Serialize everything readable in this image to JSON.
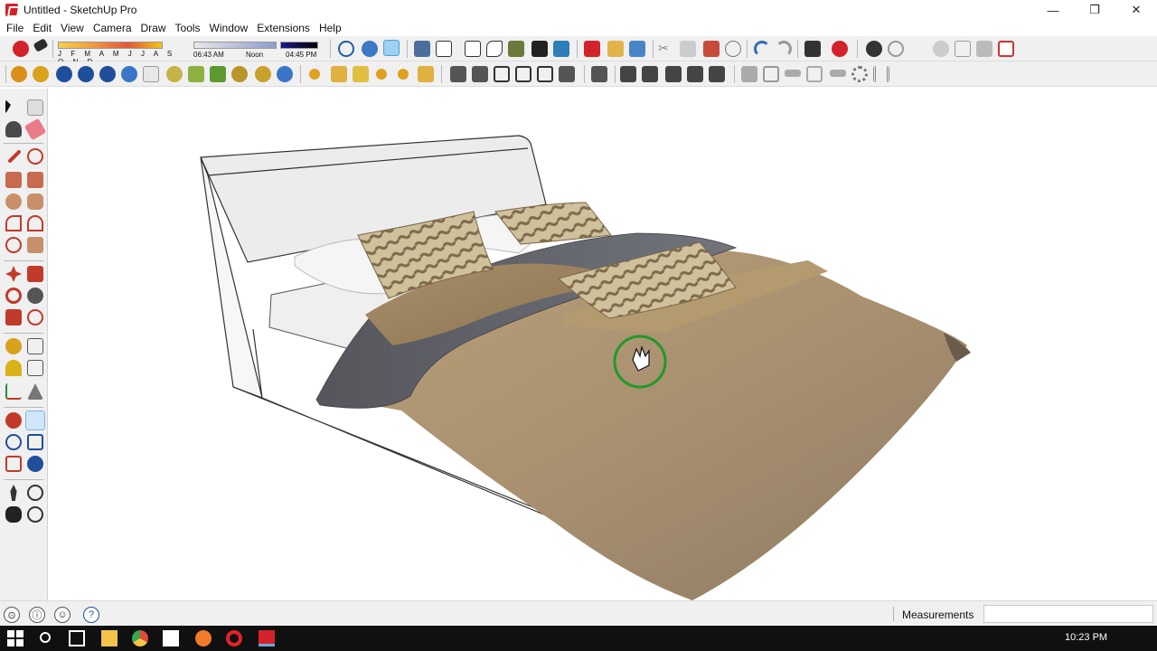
{
  "window": {
    "title": "Untitled - SketchUp Pro",
    "minimize_glyph": "—",
    "restore_glyph": "❐",
    "close_glyph": "✕"
  },
  "menu": [
    "File",
    "Edit",
    "View",
    "Camera",
    "Draw",
    "Tools",
    "Window",
    "Extensions",
    "Help"
  ],
  "shadows": {
    "months": "J F M A M J J A S O N D",
    "time_start": "06:43 AM",
    "time_mid": "Noon",
    "time_end": "04:45 PM"
  },
  "icons": {
    "toolbar_row1": [
      "select-style-icon",
      "eraser-style-icon",
      "shadow-settings-icon",
      "orbit-icon",
      "pan-icon",
      "zoom-extents-icon",
      "iso-view-icon",
      "top-view-icon",
      "front-view-icon",
      "right-view-icon",
      "back-view-icon",
      "left-view-icon",
      "bottom-view-icon",
      "xray-icon",
      "section-plane-icon",
      "import-icon",
      "open-icon",
      "save-icon",
      "cut-icon",
      "copy-icon",
      "paste-icon",
      "erase-icon",
      "undo-icon",
      "redo-icon",
      "3d-warehouse-icon",
      "extension-warehouse-icon",
      "layout-icon",
      "components-icon",
      "materials-icon",
      "styles-icon",
      "layers-icon",
      "scenes-icon"
    ],
    "toolbar_row2": [
      "sun-icon",
      "render-icon",
      "help-icon",
      "info-icon",
      "plugin-icon",
      "plugin2-icon",
      "house-icon",
      "box-icon",
      "roof-icon",
      "window-icon",
      "door-icon",
      "section-icon",
      "dimension-icon",
      "wall-icon",
      "gear-icon",
      "column-icon"
    ],
    "left_toolbar": [
      "select-arrow-icon",
      "make-component-icon",
      "paint-bucket-icon",
      "eraser-icon",
      "line-pencil-icon",
      "freehand-icon",
      "rectangle-icon",
      "rotated-rectangle-icon",
      "circle-icon",
      "polygon-icon",
      "arc-icon",
      "pie-icon",
      "two-point-arc-icon",
      "three-point-arc-icon",
      "move-icon",
      "push-pull-icon",
      "rotate-icon",
      "follow-me-icon",
      "scale-icon",
      "offset-icon",
      "tape-measure-icon",
      "dimension-icon",
      "protractor-icon",
      "text-icon",
      "axes-icon",
      "3d-text-icon",
      "orbit-icon",
      "pan-hand-icon",
      "zoom-icon",
      "zoom-window-icon",
      "zoom-extents-icon",
      "previous-view-icon",
      "position-camera-icon",
      "look-around-icon",
      "walk-icon",
      "section-plane-icon"
    ],
    "status": [
      "geo-location-icon",
      "credits-icon",
      "user-icon",
      "help-icon"
    ],
    "taskbar": [
      "windows-start-icon",
      "search-icon",
      "task-view-icon",
      "file-explorer-icon",
      "chrome-icon",
      "mail-icon",
      "firefox-icon",
      "opera-icon",
      "sketchup-icon"
    ]
  },
  "status": {
    "measurements_label": "Measurements"
  },
  "taskbar": {
    "time": "10:23 PM"
  },
  "colors": {
    "sketchup_red": "#d3222a",
    "toolbar_bg": "#f0f0f0",
    "taskbar_bg": "#101010"
  }
}
